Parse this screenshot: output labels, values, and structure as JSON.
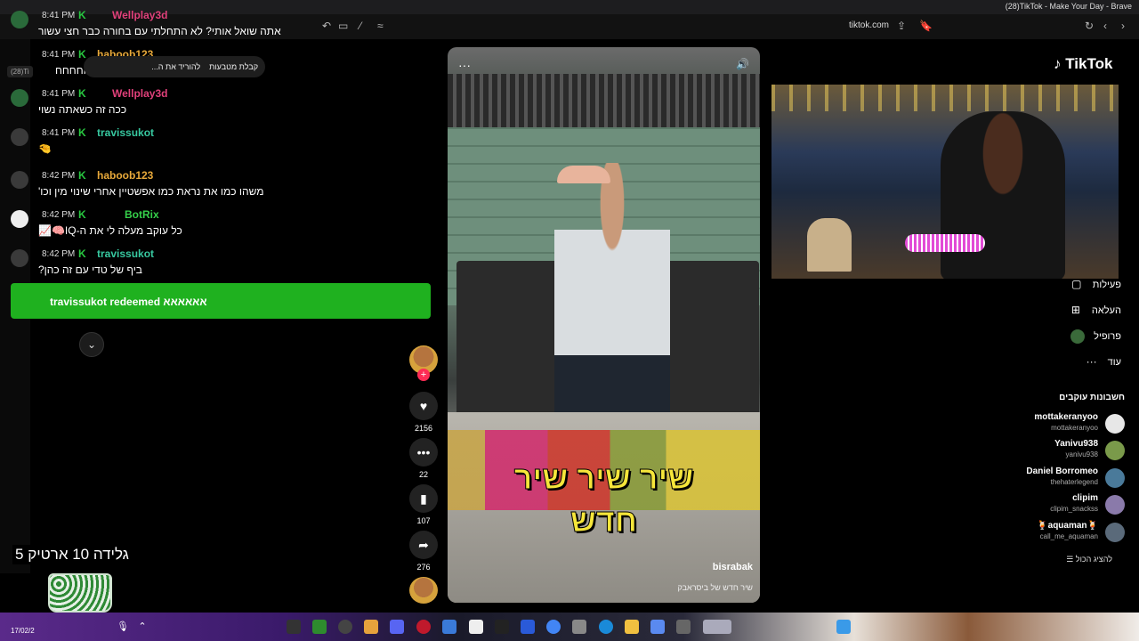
{
  "window": {
    "title": "(28)TikTok - Make Your Day - Brave"
  },
  "browser": {
    "url": "tiktok.com",
    "tab_pill": "(28)Ti"
  },
  "notice": {
    "item1": "קבלת מטבעות",
    "item2": "להוריד את ה..."
  },
  "chat": {
    "messages": [
      {
        "time": "8:41 PM",
        "name": "Wellplay3d",
        "color": "#e0407a",
        "text": "אתה שואל אותי? לא התחלתי עם בחורה כבר חצי עשור"
      },
      {
        "time": "8:41 PM",
        "name": "haboob123",
        "color": "#e8a93a",
        "text": "חחחחחחחח"
      },
      {
        "time": "8:41 PM",
        "name": "Wellplay3d",
        "color": "#e0407a",
        "text": "ככה זה כשאתה נשוי"
      },
      {
        "time": "8:41 PM",
        "name": "travissukot",
        "color": "#37c8a0",
        "text": "🤏"
      },
      {
        "time": "8:42 PM",
        "name": "haboob123",
        "color": "#e8a93a",
        "text": "משהו כמו את נראת כמו אפשטיין אחרי שינוי מין וכו'"
      },
      {
        "time": "8:42 PM",
        "name": "BotRix",
        "color": "#35d04a",
        "text": "כל עוקב מעלה לי את ה-IQ🧠📈"
      },
      {
        "time": "8:42 PM",
        "name": "travissukot",
        "color": "#37c8a0",
        "text": "ביף של טדי עם זה כהן?"
      }
    ],
    "redeem": "travissukot redeemed אאאאאא",
    "scroll_icon": "chevron-down-icon",
    "giveaway": "גלידה 10 ארטיק 5"
  },
  "video": {
    "caption_line1": "שיר שיר שיר",
    "caption_line2": "חדש",
    "username": "bisrabak",
    "description": "שיר חדש של ביסראבק",
    "actions": {
      "likes": "2156",
      "comments": "22",
      "saves": "107",
      "shares": "276"
    }
  },
  "tiktok": {
    "logo": "TikTok",
    "nav": [
      {
        "label": "פעילות",
        "icon": "activity-icon"
      },
      {
        "label": "העלאה",
        "icon": "upload-icon"
      },
      {
        "label": "פרופיל",
        "icon": "profile-icon"
      },
      {
        "label": "עוד",
        "icon": "more-icon"
      }
    ],
    "following_title": "חשבונות עוקבים",
    "accounts": [
      {
        "name": "mottakeranyoo",
        "handle": "mottakeranyoo"
      },
      {
        "name": "Yanivu938",
        "handle": "yanivu938"
      },
      {
        "name": "Daniel Borromeo",
        "handle": "thehaterlegend"
      },
      {
        "name": "clipim",
        "handle": "clipim_snackss"
      },
      {
        "name": "🍹aquaman🍹",
        "handle": "call_me_aquaman"
      }
    ],
    "show_all": "להציג הכול"
  },
  "taskbar": {
    "date": "17/02/2"
  }
}
